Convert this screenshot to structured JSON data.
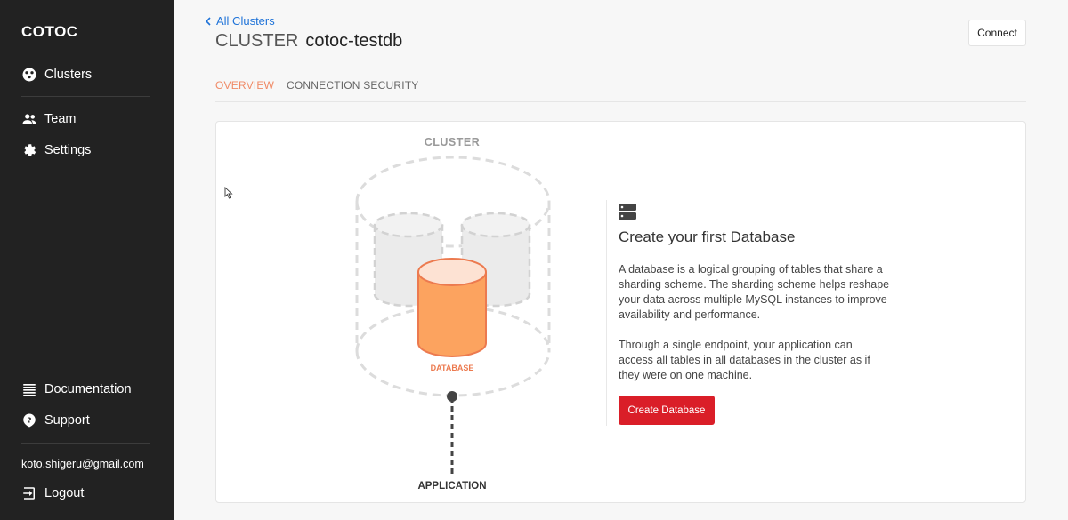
{
  "app": {
    "brand": "COTOC"
  },
  "sidebar": {
    "top_items": [
      {
        "label": "Clusters",
        "icon": "clusters-icon"
      },
      {
        "label": "Team",
        "icon": "team-icon"
      },
      {
        "label": "Settings",
        "icon": "gear-icon"
      }
    ],
    "bottom_items": [
      {
        "label": "Documentation",
        "icon": "document-icon"
      },
      {
        "label": "Support",
        "icon": "help-icon"
      }
    ],
    "user_email": "koto.shigeru@gmail.com",
    "logout_label": "Logout"
  },
  "header": {
    "back_label": "All Clusters",
    "title_kind": "CLUSTER",
    "title_name": "cotoc-testdb",
    "connect_label": "Connect"
  },
  "tabs": [
    {
      "label": "OVERVIEW",
      "active": true
    },
    {
      "label": "CONNECTION SECURITY",
      "active": false
    }
  ],
  "diagram": {
    "cluster_label": "CLUSTER",
    "database_label": "DATABASE",
    "application_label": "APPLICATION"
  },
  "empty_state": {
    "title": "Create your first Database",
    "paragraph1": "A database is a logical grouping of tables that share a sharding scheme. The sharding scheme helps reshape your data across multiple MySQL instances to improve availability and performance.",
    "paragraph2": "Through a single endpoint, your application can access all tables in all databases in the cluster as if they were on one machine.",
    "button_label": "Create Database"
  },
  "colors": {
    "accent": "#f08a66",
    "primary_button": "#da1e28",
    "link": "#1f73d8",
    "sidebar_bg": "#222222"
  }
}
